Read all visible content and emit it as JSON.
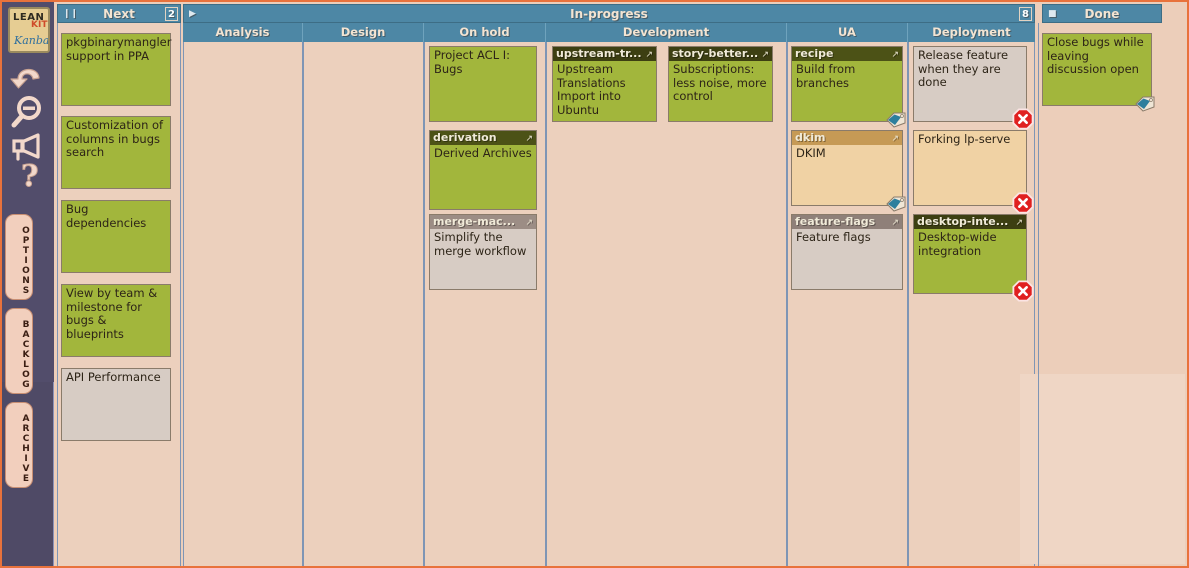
{
  "app": {
    "logo": {
      "lean": "LEAN",
      "kit": "KIT",
      "kanban": "Kanban"
    },
    "accent_orange": "#e8723c",
    "lane_header_color": "#4d87a5",
    "board_background": "#ecd0bd"
  },
  "rail": {
    "icons": [
      {
        "name": "undo-icon",
        "glyph": "undo"
      },
      {
        "name": "zoom-out-icon",
        "glyph": "zoom-out"
      },
      {
        "name": "megaphone-icon",
        "glyph": "megaphone"
      },
      {
        "name": "help-icon",
        "glyph": "question"
      }
    ],
    "tabs": [
      {
        "label": "OPTIONS"
      },
      {
        "label": "BACKLOG"
      },
      {
        "label": "ARCHIVE"
      }
    ]
  },
  "lanes": [
    {
      "id": "next",
      "title": "Next",
      "badge": "2",
      "control": "pause"
    },
    {
      "id": "inprogress",
      "title": "In-progress",
      "badge": "8",
      "control": "collapse-right"
    },
    {
      "id": "done",
      "title": "Done",
      "badge": "",
      "control": "stop"
    }
  ],
  "columns": [
    {
      "id": "analysis",
      "label": "Analysis"
    },
    {
      "id": "design",
      "label": "Design"
    },
    {
      "id": "onhold",
      "label": "On hold"
    },
    {
      "id": "development",
      "label": "Development"
    },
    {
      "id": "ua",
      "label": "UA"
    },
    {
      "id": "deployment",
      "label": "Deployment"
    }
  ],
  "cards": {
    "next": [
      {
        "title": "",
        "body": "pkgbinarymangler support in PPA",
        "color": "green",
        "header": false,
        "tag": false,
        "blocked": false
      },
      {
        "title": "",
        "body": "Customization of columns in bugs search",
        "color": "green",
        "header": false,
        "tag": false,
        "blocked": false
      },
      {
        "title": "",
        "body": "Bug dependencies",
        "color": "green",
        "header": false,
        "tag": false,
        "blocked": false
      },
      {
        "title": "",
        "body": "View by team & milestone for bugs & blueprints",
        "color": "green",
        "header": false,
        "tag": false,
        "blocked": false
      },
      {
        "title": "",
        "body": "API Performance",
        "color": "gray",
        "header": false,
        "tag": false,
        "blocked": false
      }
    ],
    "onhold": [
      {
        "title": "",
        "body": "Project ACL I: Bugs",
        "color": "green",
        "header": false,
        "tag": false,
        "blocked": false
      },
      {
        "title": "derivation",
        "body": "Derived Archives",
        "color": "green",
        "header": true,
        "header_style": "olive",
        "tag": false,
        "blocked": false
      },
      {
        "title": "merge-mac...",
        "body": "Simplify the merge workflow",
        "color": "gray",
        "header": true,
        "header_style": "mauve",
        "tag": false,
        "blocked": false
      }
    ],
    "development": [
      {
        "title": "upstream-tr...",
        "body": "Upstream Translations Import into Ubuntu",
        "color": "green",
        "header": true,
        "header_style": "dark",
        "tag": false,
        "blocked": false
      },
      {
        "title": "story-better...",
        "body": "Subscriptions: less noise, more control",
        "color": "green",
        "header": true,
        "header_style": "dark",
        "tag": false,
        "blocked": false
      }
    ],
    "ua": [
      {
        "title": "recipe",
        "body": "Build from branches",
        "color": "green",
        "header": true,
        "header_style": "olive",
        "tag": true,
        "blocked": false
      },
      {
        "title": "dkim",
        "body": "DKIM",
        "color": "tan",
        "header": true,
        "header_style": "gold",
        "tag": true,
        "blocked": false
      },
      {
        "title": "feature-flags",
        "body": "Feature flags",
        "color": "gray",
        "header": true,
        "header_style": "mauve2",
        "tag": false,
        "blocked": false
      }
    ],
    "deployment": [
      {
        "title": "",
        "body": "Release feature when they are done",
        "color": "gray",
        "header": false,
        "tag": false,
        "blocked": true
      },
      {
        "title": "",
        "body": "Forking lp-serve",
        "color": "tan",
        "header": false,
        "tag": false,
        "blocked": true
      },
      {
        "title": "desktop-inte...",
        "body": "Desktop-wide integration",
        "color": "green",
        "header": true,
        "header_style": "dark",
        "tag": false,
        "blocked": true
      }
    ],
    "done": [
      {
        "title": "",
        "body": "Close bugs while leaving discussion open",
        "color": "green",
        "header": false,
        "tag": true,
        "blocked": false
      }
    ]
  }
}
